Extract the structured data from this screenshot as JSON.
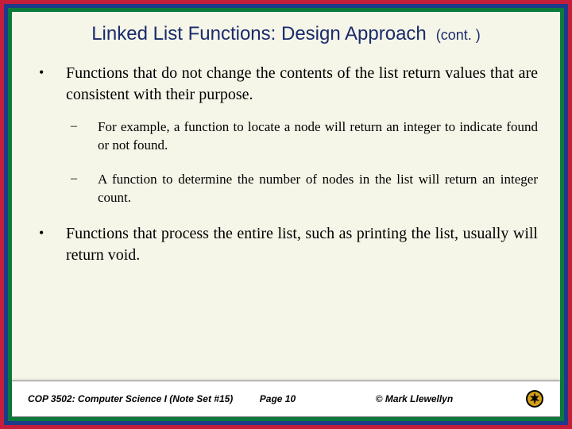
{
  "title": "Linked List Functions: Design Approach",
  "title_cont": "(cont. )",
  "bullets": [
    {
      "text": "Functions that do not change the contents of the list return values that are consistent with their purpose.",
      "subs": [
        "For example, a function to locate a node will return an integer to indicate found or not found.",
        "A function to determine the number of nodes in the list will return an integer count."
      ]
    },
    {
      "text": "Functions that process the entire list, such as printing the list, usually will return void.",
      "subs": []
    }
  ],
  "footer": {
    "course": "COP 3502: Computer Science I  (Note Set #15)",
    "page": "Page  10",
    "copyright": "© Mark Llewellyn"
  }
}
